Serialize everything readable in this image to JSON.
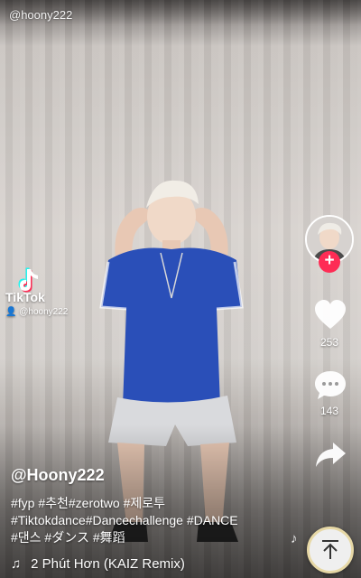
{
  "top": {
    "username": "@hoony222"
  },
  "watermark": {
    "brand": "TikTok",
    "handle": "@hoony222",
    "icon": "tiktok-logo-icon"
  },
  "rail": {
    "avatar_icon": "creator-avatar",
    "follow_symbol": "+",
    "like_count": "253",
    "comment_count": "143",
    "share_icon": "share-arrow-icon",
    "accent": "#fe2c55"
  },
  "caption": {
    "author": "@Hoony222",
    "lines": [
      "#fyp #추천#zerotwo #제로투",
      "#Tiktokdance#Dancechallenge #DANCE",
      "#댄스 #ダンス #舞蹈"
    ]
  },
  "music": {
    "note_symbol": "♫",
    "title": "2 Phút Hơn (KAIZ Remix)",
    "small_note": "♪"
  },
  "scroll_top": {
    "icon": "arrow-up-icon"
  }
}
